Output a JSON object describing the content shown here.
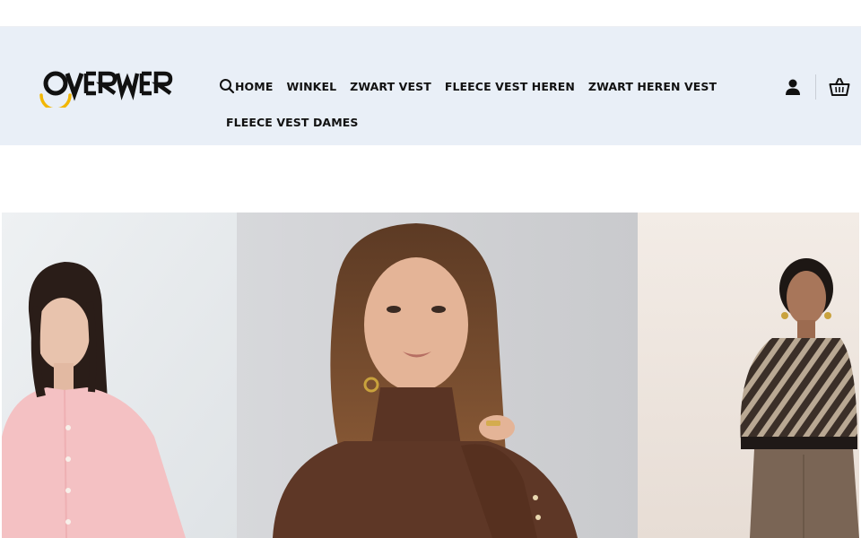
{
  "brand": {
    "logo_text": "OVERWER"
  },
  "nav": {
    "search_icon": "search-icon",
    "items": [
      "HOME",
      "WINKEL",
      "ZWART VEST",
      "FLEECE VEST HEREN",
      "ZWART HEREN VEST",
      "FLEECE VEST DAMES"
    ]
  },
  "header_icons": {
    "account": "user-icon",
    "cart": "basket-icon"
  },
  "colors": {
    "header_bg": "#e9eff7",
    "logo_accent": "#f2b705",
    "text": "#111111"
  },
  "hero": {
    "panels": [
      {
        "subject": "model in pink knit cardigan"
      },
      {
        "subject": "model in brown turtleneck sweater"
      },
      {
        "subject": "model in striped knit sweater and brown trousers"
      }
    ]
  }
}
